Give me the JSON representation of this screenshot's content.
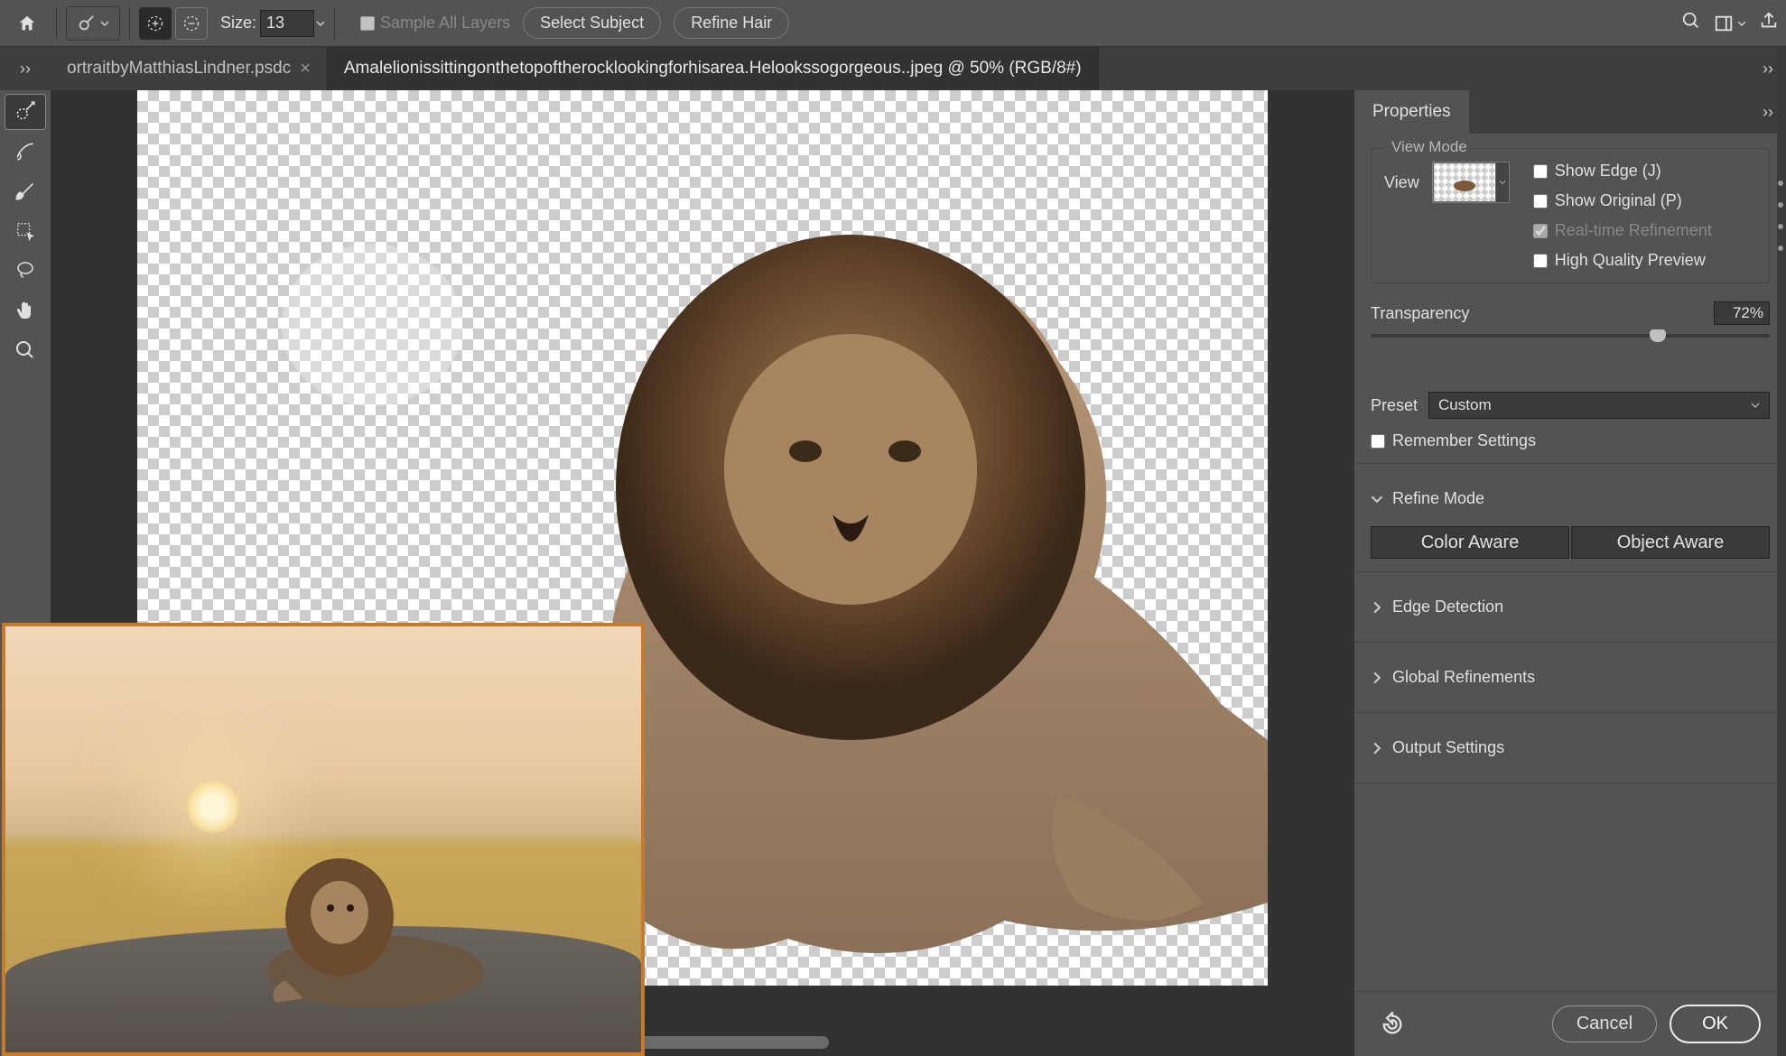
{
  "topbar": {
    "size_label": "Size:",
    "size_value": "13",
    "sample_all_label": "Sample All Layers",
    "select_subject": "Select Subject",
    "refine_hair": "Refine Hair"
  },
  "tabs": [
    {
      "label": "ortraitbyMatthiasLindner.psdc",
      "active": false
    },
    {
      "label": "Amalelionissittingonthetopoftherocklookingforhisarea.Helookssogorgeous..jpeg @ 50% (RGB/8#)",
      "active": true
    }
  ],
  "panel_tab": "Properties",
  "view_mode": {
    "title": "View Mode",
    "view_label": "View",
    "show_edge": "Show Edge (J)",
    "show_original": "Show Original (P)",
    "realtime": "Real-time Refinement",
    "hq_preview": "High Quality Preview"
  },
  "transparency": {
    "label": "Transparency",
    "value": "72%"
  },
  "preset": {
    "label": "Preset",
    "value": "Custom"
  },
  "remember": "Remember Settings",
  "refine_mode": {
    "title": "Refine Mode",
    "color_aware": "Color Aware",
    "object_aware": "Object Aware"
  },
  "sections": {
    "edge": "Edge Detection",
    "global": "Global Refinements",
    "output": "Output Settings"
  },
  "footer": {
    "cancel": "Cancel",
    "ok": "OK"
  }
}
